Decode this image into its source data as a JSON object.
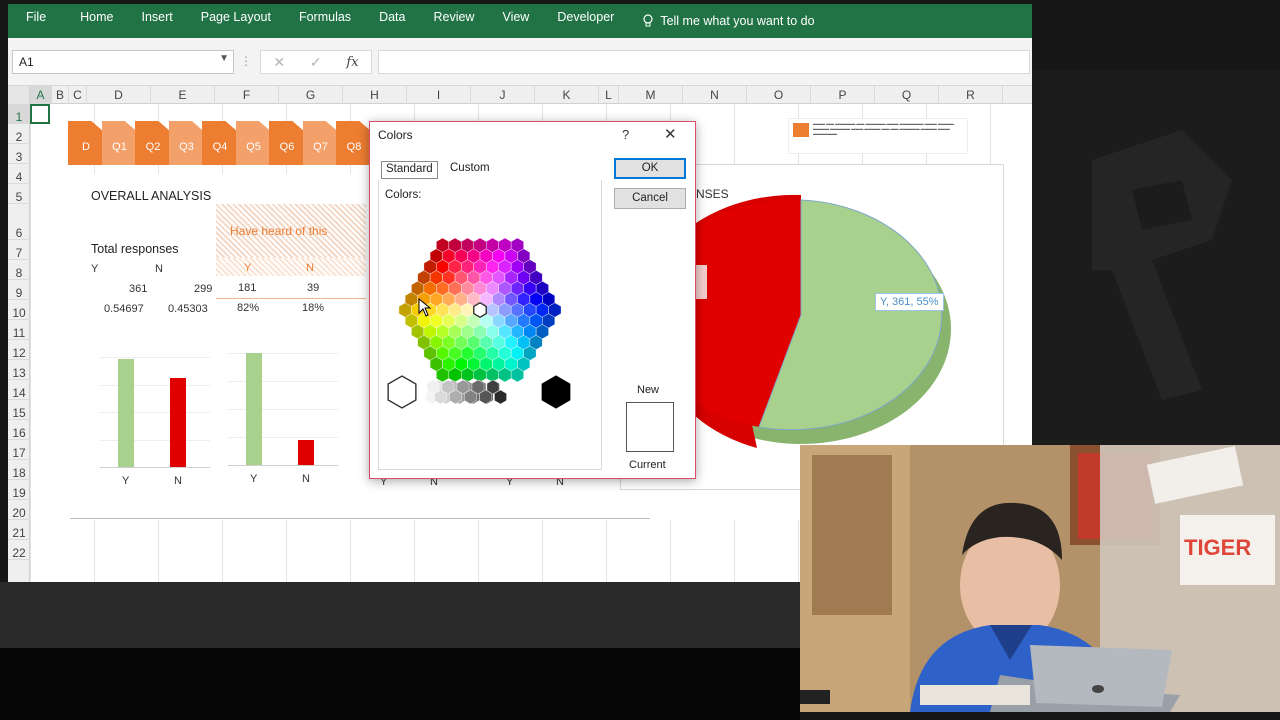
{
  "ribbon": {
    "tabs": [
      "File",
      "Home",
      "Insert",
      "Page Layout",
      "Formulas",
      "Data",
      "Review",
      "View",
      "Developer"
    ],
    "tell_me": "Tell me what you want to do"
  },
  "formula_bar": {
    "name_box": "A1",
    "cancel_glyph": "✕",
    "enter_glyph": "✓",
    "fx_glyph": "fx",
    "value": ""
  },
  "columns": [
    "A",
    "B",
    "C",
    "D",
    "E",
    "F",
    "G",
    "H",
    "I",
    "J",
    "K",
    "L",
    "M",
    "N",
    "O",
    "P",
    "Q",
    "R"
  ],
  "rows": [
    "1",
    "2",
    "3",
    "4",
    "5",
    "6",
    "7",
    "8",
    "9",
    "10",
    "11",
    "12",
    "13",
    "14",
    "15",
    "16",
    "17",
    "18",
    "19",
    "20",
    "21",
    "22"
  ],
  "dashboard": {
    "chevrons": [
      "D",
      "Q1",
      "Q2",
      "Q3",
      "Q4",
      "Q5",
      "Q6",
      "Q7",
      "Q8"
    ],
    "overall_title": "OVERALL ANALYSIS",
    "question_text": "Have heard of this",
    "total_label": "Total responses",
    "left_table": {
      "headers": [
        "Y",
        "N"
      ],
      "counts": [
        "361",
        "299"
      ],
      "ratios": [
        "0.54697",
        "0.45303"
      ]
    },
    "mid_table": {
      "headers": [
        "Y",
        "N"
      ],
      "counts": [
        "181",
        "39"
      ],
      "percents": [
        "82%",
        "18%"
      ]
    },
    "pie_title_partial": "NSES",
    "pie_label": "Y, 361, 55%",
    "bar_chart_1": {
      "categories": [
        "Y",
        "N"
      ],
      "values": [
        0.547,
        0.453
      ]
    },
    "bar_chart_2": {
      "categories": [
        "Y",
        "N"
      ],
      "values": [
        0.82,
        0.18
      ]
    },
    "bar_chart_3": {
      "categories": [
        "Y",
        "N",
        "Y",
        "N"
      ]
    },
    "colors": {
      "yes": "#a9d18e",
      "no": "#e00000",
      "accent": "#ed7d31",
      "excel_green": "#217346"
    }
  },
  "dialog": {
    "title": "Colors",
    "help": "?",
    "close": "✕",
    "tabs": [
      "Standard",
      "Custom"
    ],
    "colors_label": "Colors:",
    "ok": "OK",
    "cancel": "Cancel",
    "new_label": "New",
    "current_label": "Current"
  }
}
